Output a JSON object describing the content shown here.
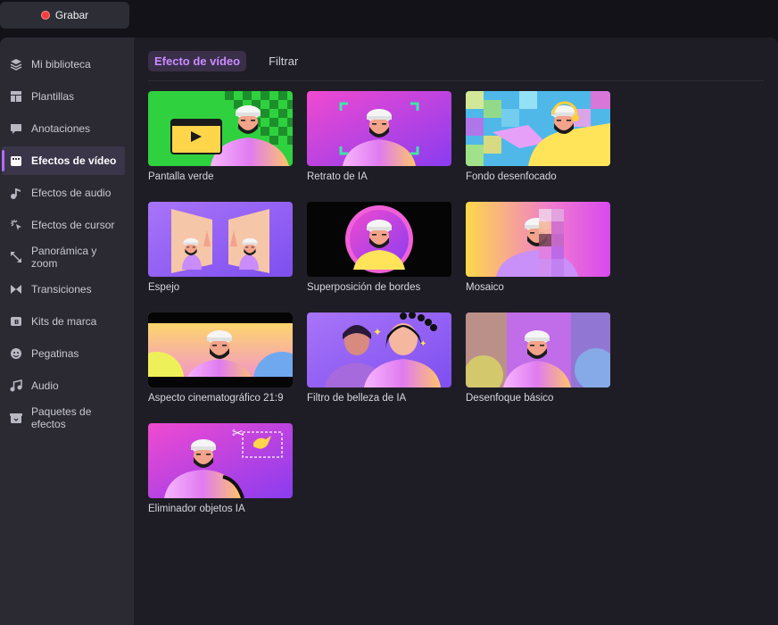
{
  "top": {
    "record_label": "Grabar"
  },
  "sidebar": {
    "items": [
      {
        "label": "Mi biblioteca",
        "icon": "layers-icon"
      },
      {
        "label": "Plantillas",
        "icon": "template-icon"
      },
      {
        "label": "Anotaciones",
        "icon": "annotation-icon"
      },
      {
        "label": "Efectos de vídeo",
        "icon": "video-effects-icon",
        "active": true
      },
      {
        "label": "Efectos de audio",
        "icon": "music-note-icon"
      },
      {
        "label": "Efectos de cursor",
        "icon": "cursor-icon"
      },
      {
        "label": "Panorámica y zoom",
        "icon": "zoom-icon"
      },
      {
        "label": "Transiciones",
        "icon": "transition-icon"
      },
      {
        "label": "Kits de marca",
        "icon": "brand-kit-icon"
      },
      {
        "label": "Pegatinas",
        "icon": "sticker-icon"
      },
      {
        "label": "Audio",
        "icon": "audio-icon"
      },
      {
        "label": "Paquetes de efectos",
        "icon": "effects-pack-icon"
      }
    ]
  },
  "main": {
    "tabs": [
      {
        "label": "Efecto de vídeo",
        "active": true
      },
      {
        "label": "Filtrar"
      }
    ],
    "effects": [
      {
        "label": "Pantalla verde"
      },
      {
        "label": "Retrato de IA"
      },
      {
        "label": "Fondo desenfocado"
      },
      {
        "label": "Espejo"
      },
      {
        "label": "Superposición de bordes"
      },
      {
        "label": "Mosaico"
      },
      {
        "label": "Aspecto cinematográfico 21:9"
      },
      {
        "label": "Filtro de belleza de IA"
      },
      {
        "label": "Desenfoque básico"
      },
      {
        "label": "Eliminador objetos IA"
      }
    ]
  },
  "colors": {
    "accent": "#b06cff",
    "record": "#f23d3d"
  }
}
